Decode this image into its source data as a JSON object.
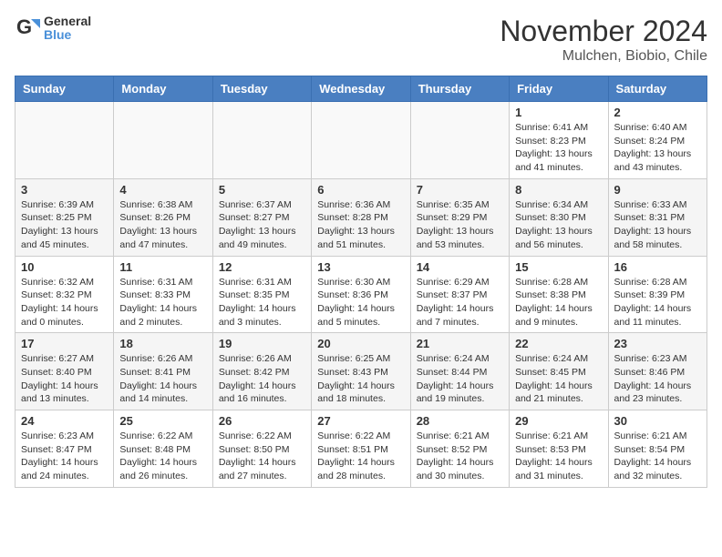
{
  "header": {
    "logo_line1": "General",
    "logo_line2": "Blue",
    "month_title": "November 2024",
    "location": "Mulchen, Biobio, Chile"
  },
  "days_of_week": [
    "Sunday",
    "Monday",
    "Tuesday",
    "Wednesday",
    "Thursday",
    "Friday",
    "Saturday"
  ],
  "weeks": [
    {
      "shade": false,
      "days": [
        {
          "num": "",
          "info": ""
        },
        {
          "num": "",
          "info": ""
        },
        {
          "num": "",
          "info": ""
        },
        {
          "num": "",
          "info": ""
        },
        {
          "num": "",
          "info": ""
        },
        {
          "num": "1",
          "info": "Sunrise: 6:41 AM\nSunset: 8:23 PM\nDaylight: 13 hours\nand 41 minutes."
        },
        {
          "num": "2",
          "info": "Sunrise: 6:40 AM\nSunset: 8:24 PM\nDaylight: 13 hours\nand 43 minutes."
        }
      ]
    },
    {
      "shade": true,
      "days": [
        {
          "num": "3",
          "info": "Sunrise: 6:39 AM\nSunset: 8:25 PM\nDaylight: 13 hours\nand 45 minutes."
        },
        {
          "num": "4",
          "info": "Sunrise: 6:38 AM\nSunset: 8:26 PM\nDaylight: 13 hours\nand 47 minutes."
        },
        {
          "num": "5",
          "info": "Sunrise: 6:37 AM\nSunset: 8:27 PM\nDaylight: 13 hours\nand 49 minutes."
        },
        {
          "num": "6",
          "info": "Sunrise: 6:36 AM\nSunset: 8:28 PM\nDaylight: 13 hours\nand 51 minutes."
        },
        {
          "num": "7",
          "info": "Sunrise: 6:35 AM\nSunset: 8:29 PM\nDaylight: 13 hours\nand 53 minutes."
        },
        {
          "num": "8",
          "info": "Sunrise: 6:34 AM\nSunset: 8:30 PM\nDaylight: 13 hours\nand 56 minutes."
        },
        {
          "num": "9",
          "info": "Sunrise: 6:33 AM\nSunset: 8:31 PM\nDaylight: 13 hours\nand 58 minutes."
        }
      ]
    },
    {
      "shade": false,
      "days": [
        {
          "num": "10",
          "info": "Sunrise: 6:32 AM\nSunset: 8:32 PM\nDaylight: 14 hours\nand 0 minutes."
        },
        {
          "num": "11",
          "info": "Sunrise: 6:31 AM\nSunset: 8:33 PM\nDaylight: 14 hours\nand 2 minutes."
        },
        {
          "num": "12",
          "info": "Sunrise: 6:31 AM\nSunset: 8:35 PM\nDaylight: 14 hours\nand 3 minutes."
        },
        {
          "num": "13",
          "info": "Sunrise: 6:30 AM\nSunset: 8:36 PM\nDaylight: 14 hours\nand 5 minutes."
        },
        {
          "num": "14",
          "info": "Sunrise: 6:29 AM\nSunset: 8:37 PM\nDaylight: 14 hours\nand 7 minutes."
        },
        {
          "num": "15",
          "info": "Sunrise: 6:28 AM\nSunset: 8:38 PM\nDaylight: 14 hours\nand 9 minutes."
        },
        {
          "num": "16",
          "info": "Sunrise: 6:28 AM\nSunset: 8:39 PM\nDaylight: 14 hours\nand 11 minutes."
        }
      ]
    },
    {
      "shade": true,
      "days": [
        {
          "num": "17",
          "info": "Sunrise: 6:27 AM\nSunset: 8:40 PM\nDaylight: 14 hours\nand 13 minutes."
        },
        {
          "num": "18",
          "info": "Sunrise: 6:26 AM\nSunset: 8:41 PM\nDaylight: 14 hours\nand 14 minutes."
        },
        {
          "num": "19",
          "info": "Sunrise: 6:26 AM\nSunset: 8:42 PM\nDaylight: 14 hours\nand 16 minutes."
        },
        {
          "num": "20",
          "info": "Sunrise: 6:25 AM\nSunset: 8:43 PM\nDaylight: 14 hours\nand 18 minutes."
        },
        {
          "num": "21",
          "info": "Sunrise: 6:24 AM\nSunset: 8:44 PM\nDaylight: 14 hours\nand 19 minutes."
        },
        {
          "num": "22",
          "info": "Sunrise: 6:24 AM\nSunset: 8:45 PM\nDaylight: 14 hours\nand 21 minutes."
        },
        {
          "num": "23",
          "info": "Sunrise: 6:23 AM\nSunset: 8:46 PM\nDaylight: 14 hours\nand 23 minutes."
        }
      ]
    },
    {
      "shade": false,
      "days": [
        {
          "num": "24",
          "info": "Sunrise: 6:23 AM\nSunset: 8:47 PM\nDaylight: 14 hours\nand 24 minutes."
        },
        {
          "num": "25",
          "info": "Sunrise: 6:22 AM\nSunset: 8:48 PM\nDaylight: 14 hours\nand 26 minutes."
        },
        {
          "num": "26",
          "info": "Sunrise: 6:22 AM\nSunset: 8:50 PM\nDaylight: 14 hours\nand 27 minutes."
        },
        {
          "num": "27",
          "info": "Sunrise: 6:22 AM\nSunset: 8:51 PM\nDaylight: 14 hours\nand 28 minutes."
        },
        {
          "num": "28",
          "info": "Sunrise: 6:21 AM\nSunset: 8:52 PM\nDaylight: 14 hours\nand 30 minutes."
        },
        {
          "num": "29",
          "info": "Sunrise: 6:21 AM\nSunset: 8:53 PM\nDaylight: 14 hours\nand 31 minutes."
        },
        {
          "num": "30",
          "info": "Sunrise: 6:21 AM\nSunset: 8:54 PM\nDaylight: 14 hours\nand 32 minutes."
        }
      ]
    }
  ]
}
